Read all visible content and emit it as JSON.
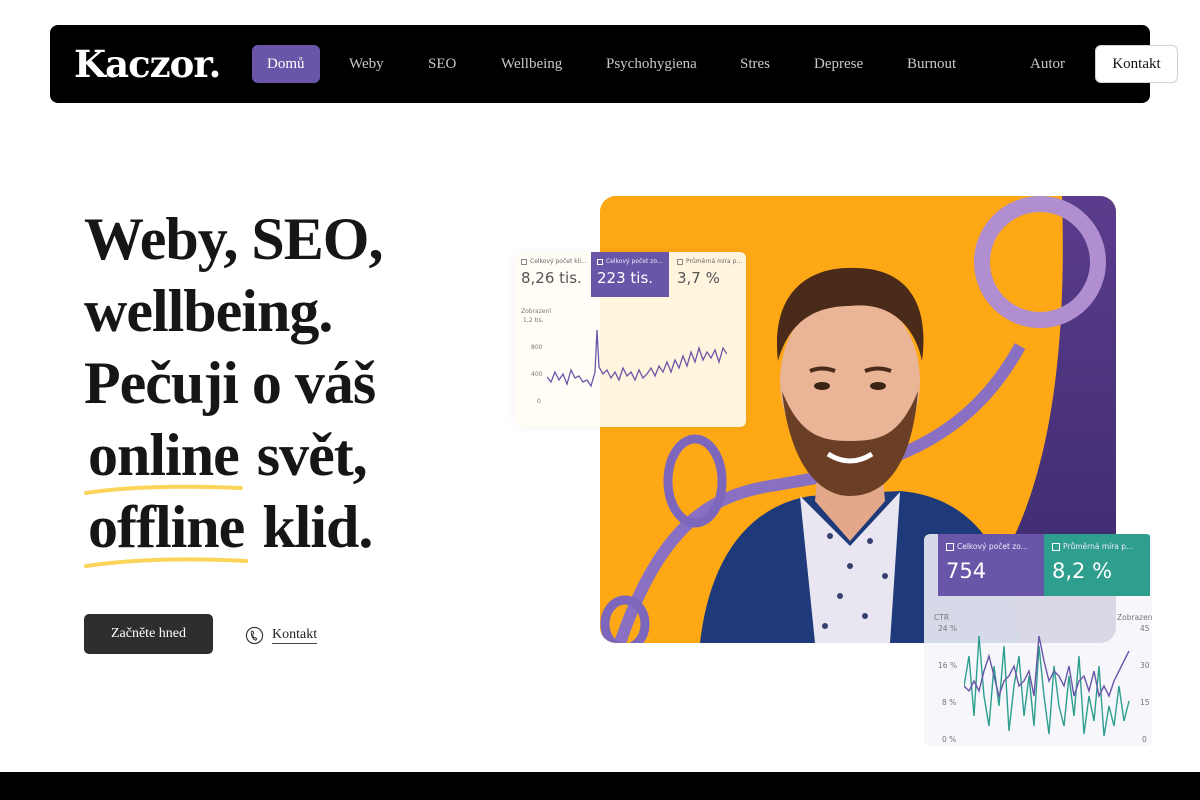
{
  "nav": {
    "logo": "Kaczor.",
    "items": [
      {
        "label": "Domů",
        "active": true
      },
      {
        "label": "Weby"
      },
      {
        "label": "SEO"
      },
      {
        "label": "Wellbeing"
      },
      {
        "label": "Psychohygiena"
      },
      {
        "label": "Stres"
      },
      {
        "label": "Deprese"
      },
      {
        "label": "Burnout"
      },
      {
        "label": "Autor"
      }
    ],
    "contact_button": "Kontakt"
  },
  "hero": {
    "line1": "Weby, SEO,",
    "line2": "wellbeing.",
    "line3": "Pečuji o váš",
    "line4_highlight": "online",
    "line4_rest": " svět,",
    "line5_highlight": "offline",
    "line5_rest": " klid.",
    "cta_primary": "Začněte hned",
    "cta_link": "Kontakt"
  },
  "card_top": {
    "metrics": [
      {
        "label": "Celkový počet kli...",
        "value": "8,26 tis.",
        "active": false
      },
      {
        "label": "Celkový počet zo...",
        "value": "223 tis.",
        "active": true
      },
      {
        "label": "Průměrná míra p...",
        "value": "3,7 %",
        "active": false
      }
    ],
    "axis_title": "Zobrazení",
    "axis_ticks": [
      "1,2 tis.",
      "800",
      "400",
      "0"
    ]
  },
  "card_bottom": {
    "metrics": [
      {
        "label": "Celkový počet zo...",
        "value": "754",
        "active": true
      },
      {
        "label": "Průměrná míra p...",
        "value": "8,2 %",
        "active": true
      }
    ],
    "left_axis_title": "CTR",
    "right_axis_title": "Zobrazení",
    "left_ticks": [
      "24 %",
      "16 %",
      "8 %",
      "0 %"
    ],
    "right_ticks": [
      "45",
      "30",
      "15",
      "0"
    ]
  },
  "colors": {
    "accent_purple": "#6a56a8",
    "hero_orange": "#fda814",
    "highlight_yellow": "#fbd45a",
    "teal": "#2e9f8f"
  }
}
